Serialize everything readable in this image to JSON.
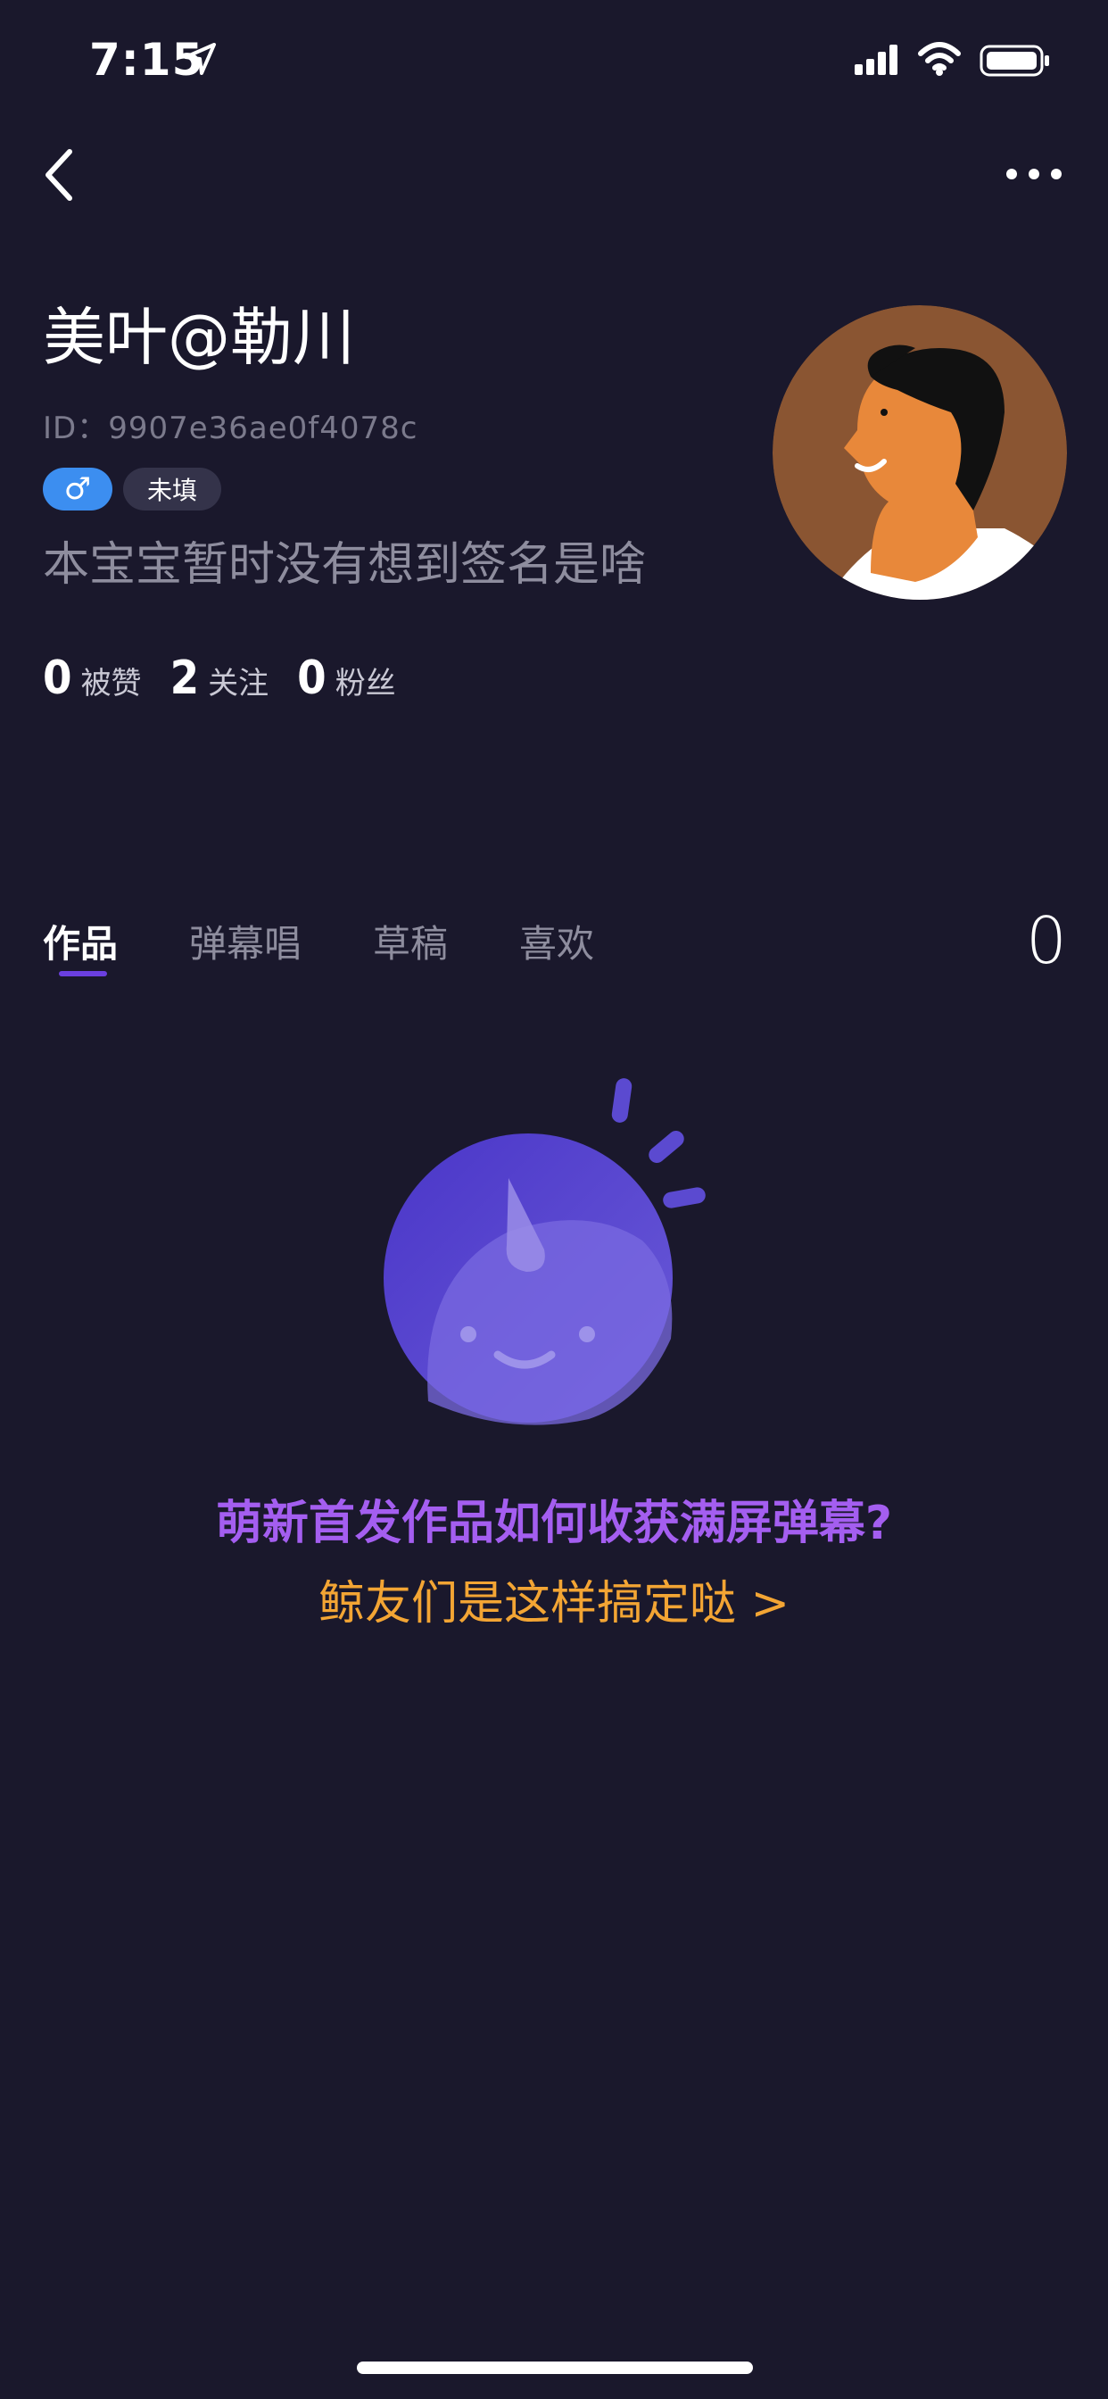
{
  "status_bar": {
    "time": "7:15"
  },
  "profile": {
    "name": "美叶@勒川",
    "id": "ID：9907e36ae0f4078c",
    "gender_symbol": "♂",
    "region_tag": "未填",
    "signature": "本宝宝暂时没有想到签名是啥",
    "stats": [
      {
        "value": "0",
        "label": "被赞"
      },
      {
        "value": "2",
        "label": "关注"
      },
      {
        "value": "0",
        "label": "粉丝"
      }
    ]
  },
  "tabs": {
    "items": [
      "作品",
      "弹幕唱",
      "草稿",
      "喜欢"
    ],
    "active_index": 0,
    "count": "0"
  },
  "empty_state": {
    "title": "萌新首发作品如何收获满屏弹幕?",
    "link": "鲸友们是这样搞定哒 >"
  },
  "colors": {
    "background": "#1a182c",
    "accent_purple": "#a45ef0",
    "accent_orange": "#f3a534",
    "gender_blue": "#3c8ef0"
  },
  "icons": {
    "back": "chevron-left-icon",
    "more": "more-dots-icon",
    "location": "location-arrow-icon",
    "signal": "cellular-signal-icon",
    "wifi": "wifi-icon",
    "battery": "battery-icon"
  }
}
